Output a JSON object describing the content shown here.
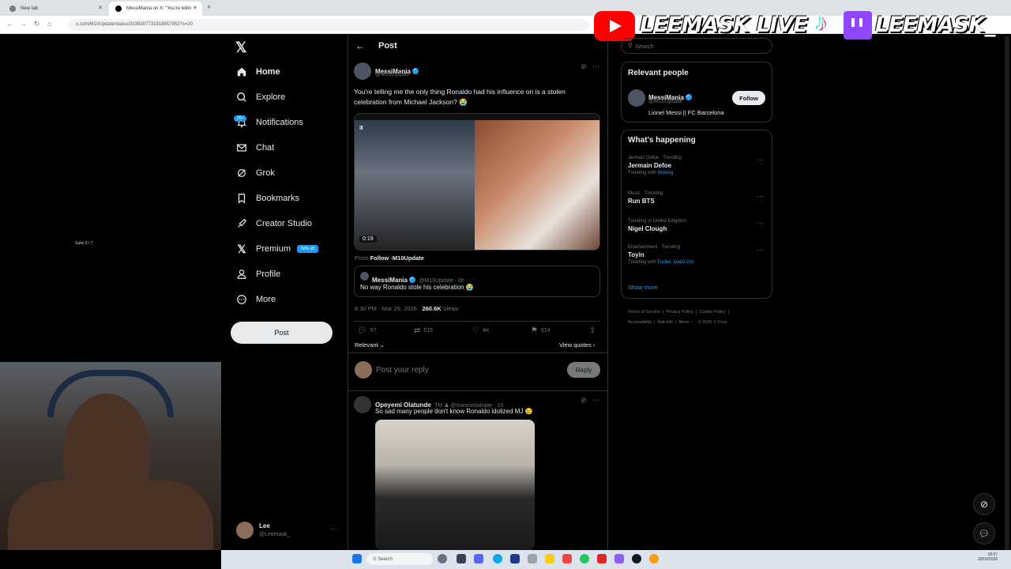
{
  "browser": {
    "tabs": [
      {
        "label": "New tab"
      },
      {
        "label": "MessiMania on X: \"You're tellin"
      }
    ],
    "url": "x.com/M10Update/status/2038307731918857952?s=20"
  },
  "overlay": {
    "left_text": "LEEMASK LIVE",
    "right_text": "LEEMASK_",
    "subs": "Subs 0 / 7"
  },
  "nav": {
    "items": [
      {
        "label": "Home"
      },
      {
        "label": "Explore"
      },
      {
        "label": "Notifications",
        "badge": "20+"
      },
      {
        "label": "Chat"
      },
      {
        "label": "Grok"
      },
      {
        "label": "Bookmarks"
      },
      {
        "label": "Creator Studio"
      },
      {
        "label": "Premium",
        "badge": "50% off"
      },
      {
        "label": "Profile"
      },
      {
        "label": "More"
      }
    ],
    "post_button": "Post",
    "account": {
      "name": "Lee",
      "handle": "@Leemask_"
    }
  },
  "main": {
    "header": "Post",
    "tweet": {
      "name": "MessiMania",
      "handle": "@M10Update",
      "text": "You're telling me the only thing Ronaldo had his influence on is a stolen celebration from Michael Jackson? 😭",
      "video_duration": "0:19",
      "from_prefix": "From",
      "from_source": "Follow -M10Update",
      "quote": {
        "name": "MessiMania",
        "handle": "@M10Update · 6h",
        "text": "No way Ronaldo stole his celebration 😭"
      },
      "timestamp": "6:30 PM · Mar 29, 2026 · ",
      "views": "260.6K",
      "views_label": " Views",
      "stats": {
        "replies": "57",
        "reposts": "515",
        "likes": "4K",
        "bookmarks": "614"
      },
      "relevant": "Relevant ⌄",
      "view_quotes": "View quotes ›"
    },
    "reply_box": {
      "placeholder": "Post your reply",
      "button": "Reply"
    },
    "reply": {
      "name": "Opeyemi Olatunde",
      "handle": "TM ♟ @mancunlaloper · 1h",
      "text": "So sad many people don't know Ronaldo idolized MJ 😢"
    }
  },
  "right": {
    "search_placeholder": "Search",
    "relevant_title": "Relevant people",
    "relevant_person": {
      "name": "MessiMania",
      "handle": "@M10Update",
      "bio": "Lionel Messi || FC Barcelona",
      "follow": "Follow"
    },
    "happening_title": "What's happening",
    "trends": [
      {
        "meta": "Jermain Defoe · Trending",
        "name": "Jermain Defoe",
        "with": "Trending with ",
        "link": "Woking"
      },
      {
        "meta": "Music · Trending",
        "name": "Run BTS",
        "with": "",
        "link": ""
      },
      {
        "meta": "Trending in United Kingdom",
        "name": "Nigel Clough",
        "with": "",
        "link": ""
      },
      {
        "meta": "Entertainment · Trending",
        "name": "Toyin",
        "with": "Trending with ",
        "link": "Funke, Iyabo Ojo"
      }
    ],
    "show_more": "Show more",
    "footer": [
      "Terms of Service",
      "Privacy Policy",
      "Cookie Policy",
      "Accessibility",
      "Ads info",
      "More ···",
      "© 2026 X Corp."
    ]
  },
  "taskbar": {
    "search": "Search",
    "time": "18:57",
    "date": "29/03/2026"
  }
}
